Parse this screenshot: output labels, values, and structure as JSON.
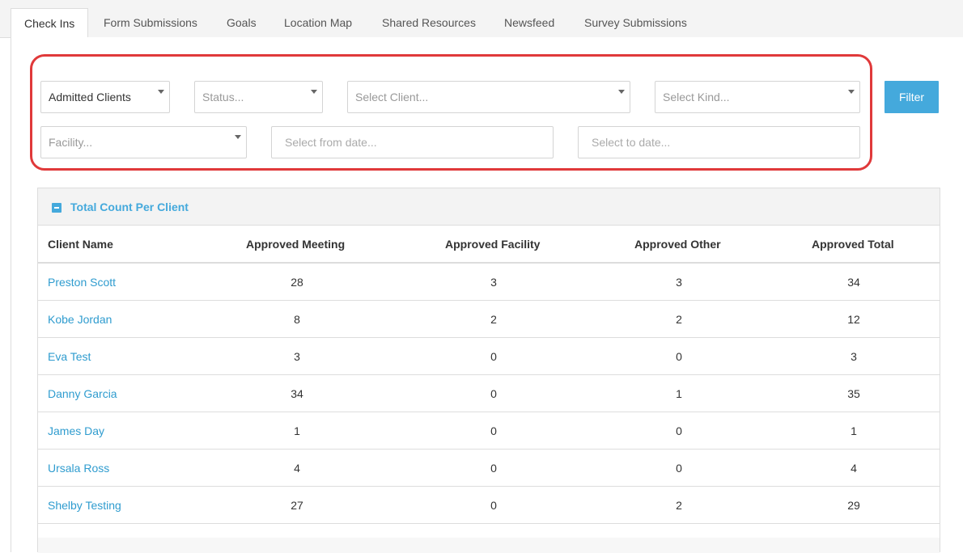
{
  "tabs": [
    {
      "label": "Check Ins",
      "active": true
    },
    {
      "label": "Form Submissions",
      "active": false
    },
    {
      "label": "Goals",
      "active": false
    },
    {
      "label": "Location Map",
      "active": false
    },
    {
      "label": "Shared Resources",
      "active": false
    },
    {
      "label": "Newsfeed",
      "active": false
    },
    {
      "label": "Survey Submissions",
      "active": false
    }
  ],
  "filters": {
    "admission_select": {
      "value": "Admitted Clients"
    },
    "status_select": {
      "placeholder": "Status..."
    },
    "client_select": {
      "placeholder": "Select Client..."
    },
    "kind_select": {
      "placeholder": "Select Kind..."
    },
    "facility_select": {
      "placeholder": "Facility..."
    },
    "from_date": {
      "placeholder": "Select from date..."
    },
    "to_date": {
      "placeholder": "Select to date..."
    },
    "filter_button_label": "Filter"
  },
  "highlight_color": "#e0393a",
  "accent_color": "#44a9dc",
  "table": {
    "title": "Total Count Per Client",
    "columns": [
      "Client Name",
      "Approved Meeting",
      "Approved Facility",
      "Approved Other",
      "Approved Total"
    ],
    "rows": [
      {
        "name": "Preston Scott",
        "meeting": "28",
        "facility": "3",
        "other": "3",
        "total": "34"
      },
      {
        "name": "Kobe Jordan",
        "meeting": "8",
        "facility": "2",
        "other": "2",
        "total": "12"
      },
      {
        "name": "Eva Test",
        "meeting": "3",
        "facility": "0",
        "other": "0",
        "total": "3"
      },
      {
        "name": "Danny Garcia",
        "meeting": "34",
        "facility": "0",
        "other": "1",
        "total": "35"
      },
      {
        "name": "James Day",
        "meeting": "1",
        "facility": "0",
        "other": "0",
        "total": "1"
      },
      {
        "name": "Ursala Ross",
        "meeting": "4",
        "facility": "0",
        "other": "0",
        "total": "4"
      },
      {
        "name": "Shelby Testing",
        "meeting": "27",
        "facility": "0",
        "other": "2",
        "total": "29"
      }
    ]
  }
}
